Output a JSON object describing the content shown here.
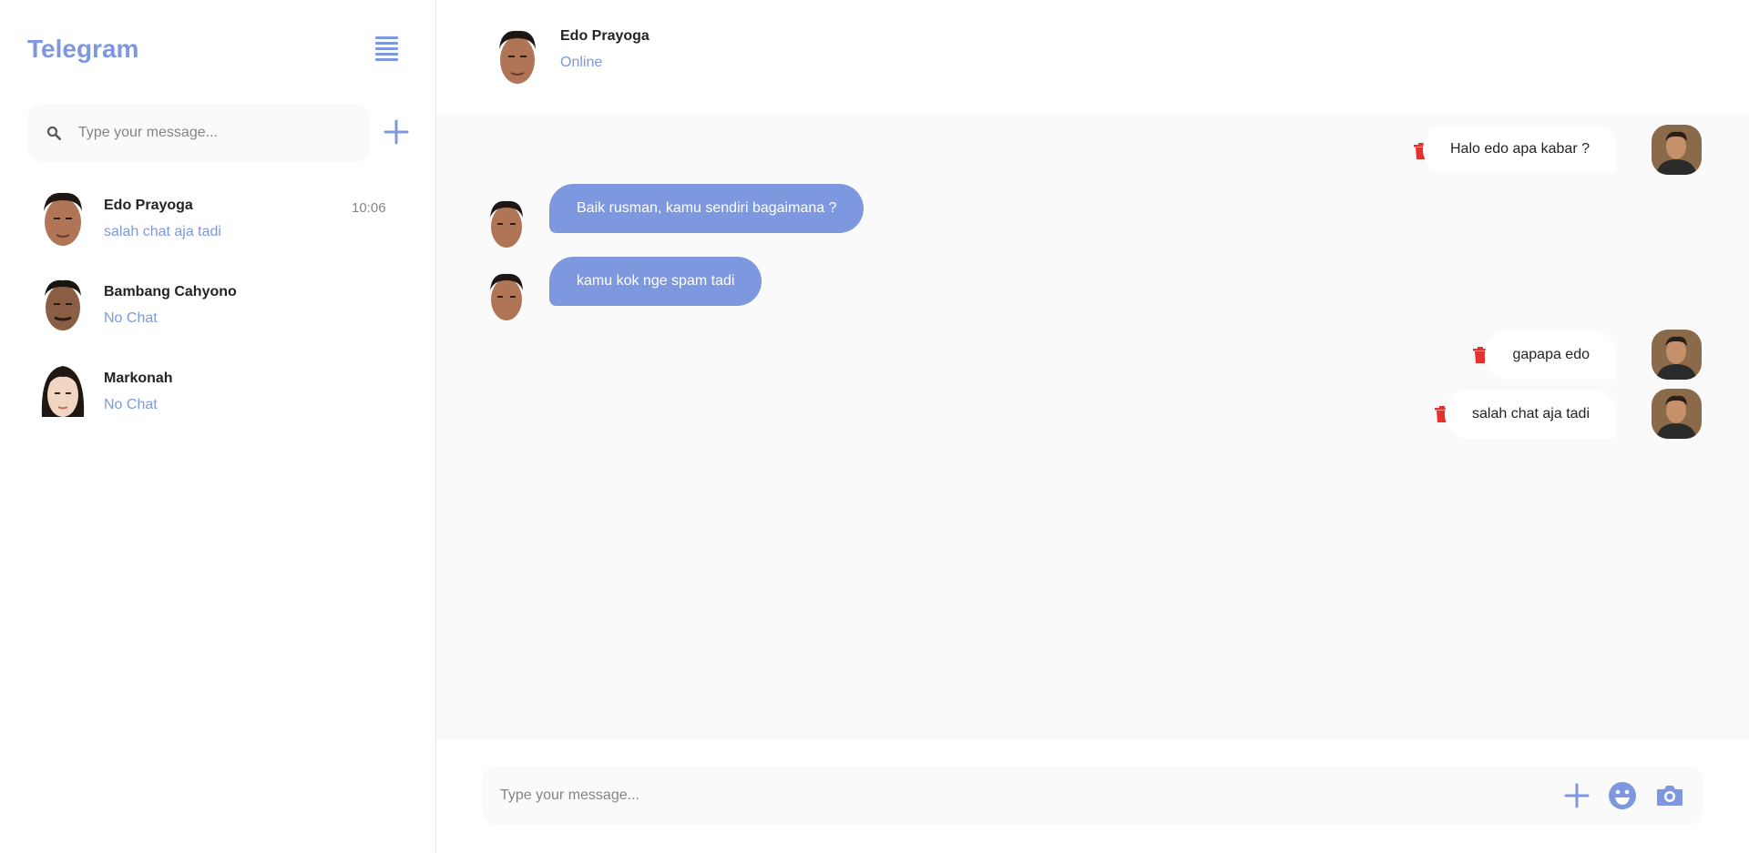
{
  "app": {
    "title": "Telegram"
  },
  "colors": {
    "accent": "#7e98df",
    "trash": "#e5322d",
    "text": "#232323",
    "muted": "#848484",
    "panel": "#fafafa"
  },
  "sidebar": {
    "search": {
      "placeholder": "Type your message..."
    },
    "chats": [
      {
        "name": "Edo Prayoga",
        "preview": "salah chat aja tadi",
        "time": "10:06"
      },
      {
        "name": "Bambang Cahyono",
        "preview": "No Chat",
        "time": ""
      },
      {
        "name": "Markonah",
        "preview": "No Chat",
        "time": ""
      }
    ]
  },
  "header": {
    "name": "Edo Prayoga",
    "status": "Online"
  },
  "messages": [
    {
      "from": "me",
      "text": "Halo edo apa kabar ?"
    },
    {
      "from": "them",
      "text": "Baik rusman, kamu sendiri bagaimana ?"
    },
    {
      "from": "them",
      "text": "kamu kok nge spam tadi"
    },
    {
      "from": "me",
      "text": "gapapa edo"
    },
    {
      "from": "me",
      "text": "salah chat aja tadi"
    }
  ],
  "composer": {
    "placeholder": "Type your message...",
    "icons": [
      "plus-icon",
      "emoji-icon",
      "camera-icon"
    ]
  }
}
